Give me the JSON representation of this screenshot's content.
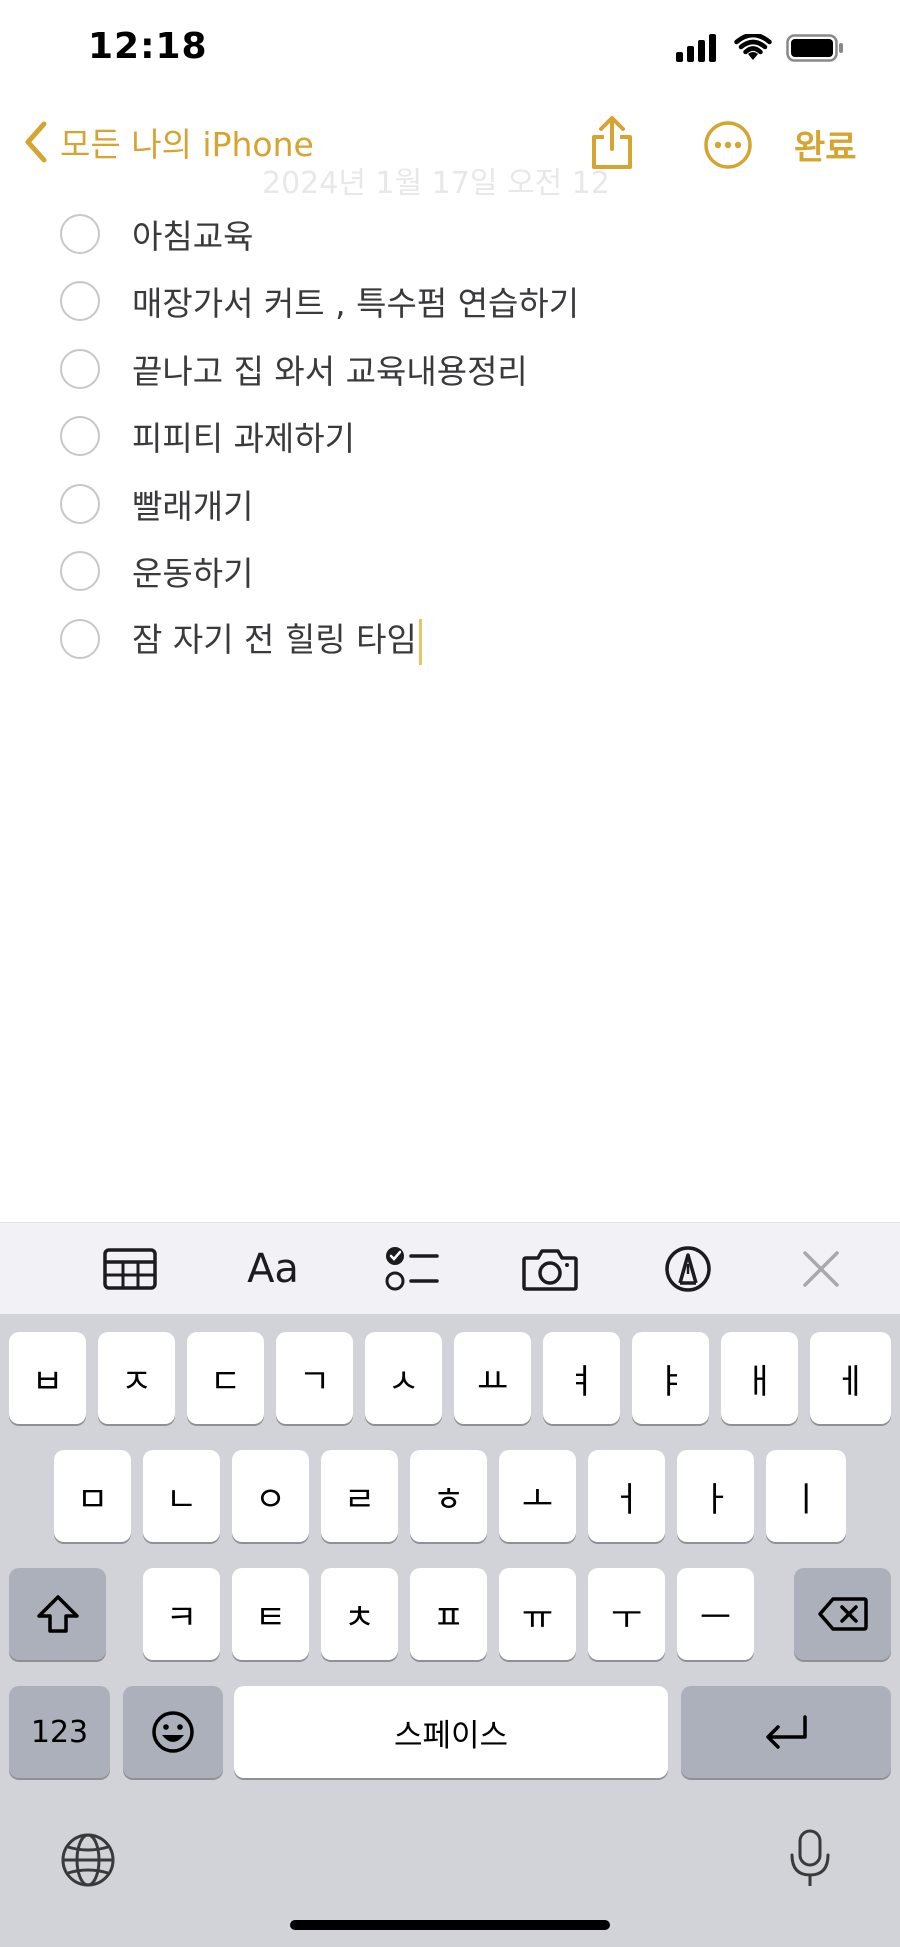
{
  "status_bar": {
    "time": "12:18",
    "icons": [
      "signal-icon",
      "wifi-icon",
      "battery-icon"
    ]
  },
  "nav": {
    "back_label": "모든 나의 iPhone",
    "done_label": "완료",
    "faded_date": "2024년 1월 17일 오전 12"
  },
  "checklist": [
    {
      "text": "아침교육"
    },
    {
      "text": "매장가서 커트 , 특수펌 연습하기"
    },
    {
      "text": "끝나고 집 와서 교육내용정리"
    },
    {
      "text": "피피티 과제하기"
    },
    {
      "text": "빨래개기"
    },
    {
      "text": "운동하기"
    },
    {
      "text": "잠 자기 전 힐링 타임"
    }
  ],
  "toolbar": {
    "format_label": "Aa",
    "icons": [
      "table-icon",
      "text-format-icon",
      "checklist-icon",
      "camera-icon",
      "markup-icon",
      "close-icon"
    ]
  },
  "keyboard": {
    "row1": [
      "ㅂ",
      "ㅈ",
      "ㄷ",
      "ㄱ",
      "ㅅ",
      "ㅛ",
      "ㅕ",
      "ㅑ",
      "ㅐ",
      "ㅔ"
    ],
    "row2": [
      "ㅁ",
      "ㄴ",
      "ㅇ",
      "ㄹ",
      "ㅎ",
      "ㅗ",
      "ㅓ",
      "ㅏ",
      "ㅣ"
    ],
    "row3": [
      "ㅋ",
      "ㅌ",
      "ㅊ",
      "ㅍ",
      "ㅠ",
      "ㅜ",
      "ㅡ"
    ],
    "numbers_label": "123",
    "space_label": "스페이스",
    "accent": "#d5a431"
  }
}
